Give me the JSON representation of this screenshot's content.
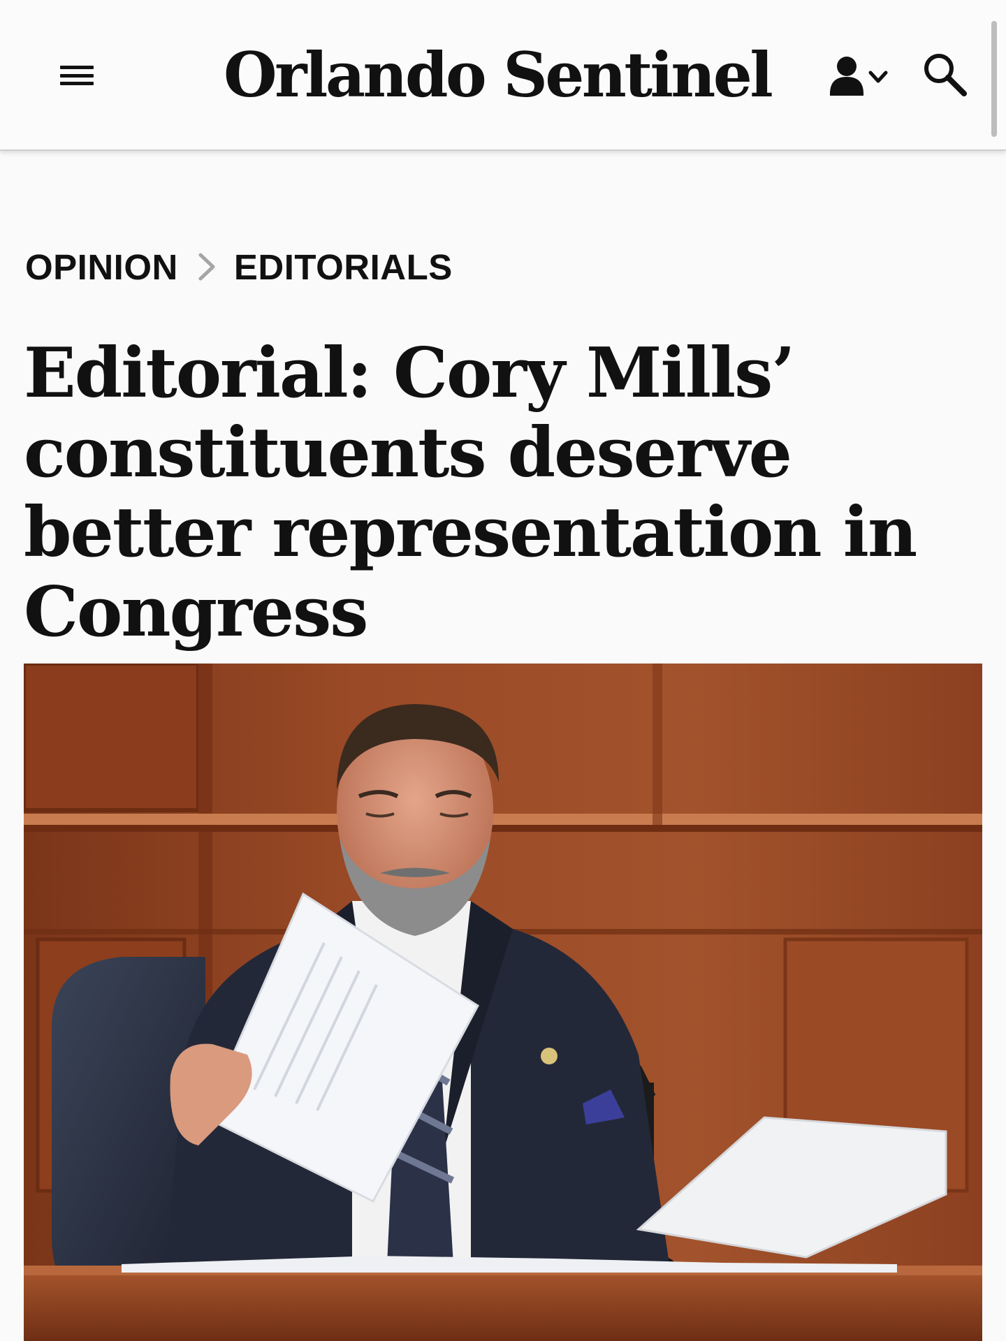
{
  "header": {
    "masthead": "Orlando Sentinel",
    "menu_icon": "hamburger-menu-icon",
    "account_icon": "user-account-icon",
    "search_icon": "search-icon"
  },
  "breadcrumb": {
    "section": "OPINION",
    "separator_icon": "chevron-right-icon",
    "subsection": "EDITORIALS"
  },
  "article": {
    "headline": "Editorial: Cory Mills’ constituents deserve better representation in Congress"
  },
  "colors": {
    "text": "#111111",
    "header_bg": "#fbfbfb",
    "page_bg": "#fafafa",
    "separator": "#9e9e9e"
  }
}
